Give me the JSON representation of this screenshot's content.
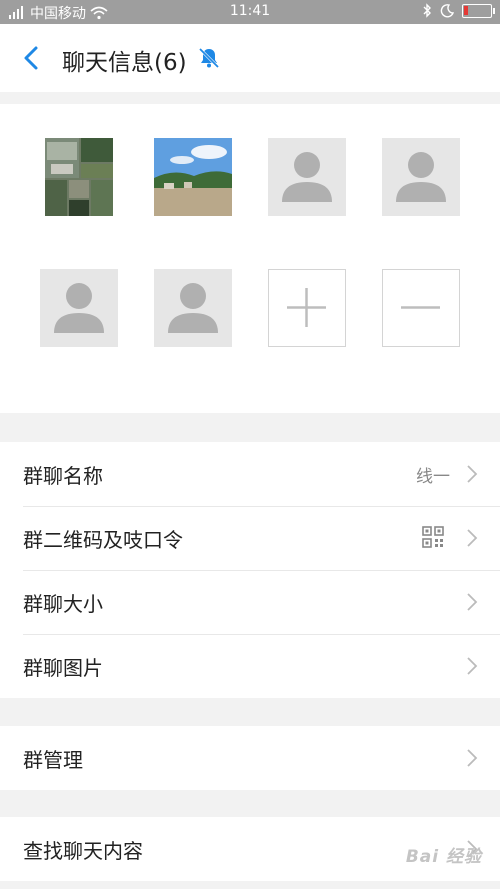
{
  "status_bar": {
    "carrier": "中国移动",
    "time": "11:41",
    "battery_level": 0.15
  },
  "header": {
    "title": "聊天信息(6)",
    "back_icon": "chevron-left-icon",
    "mute_icon": "bell-off-icon"
  },
  "members": {
    "add_icon": "plus-icon",
    "remove_icon": "minus-icon"
  },
  "settings": {
    "group_name_label": "群聊名称",
    "group_name_value": "线一",
    "qr_label": "群二维码及吱口令",
    "size_label": "群聊大小",
    "images_label": "群聊图片",
    "manage_label": "群管理",
    "search_label": "查找聊天内容"
  },
  "watermark": "Bai 经验",
  "colors": {
    "accent": "#1e88e5",
    "statusbar": "#9e9e9e",
    "battery": "#e53935"
  }
}
